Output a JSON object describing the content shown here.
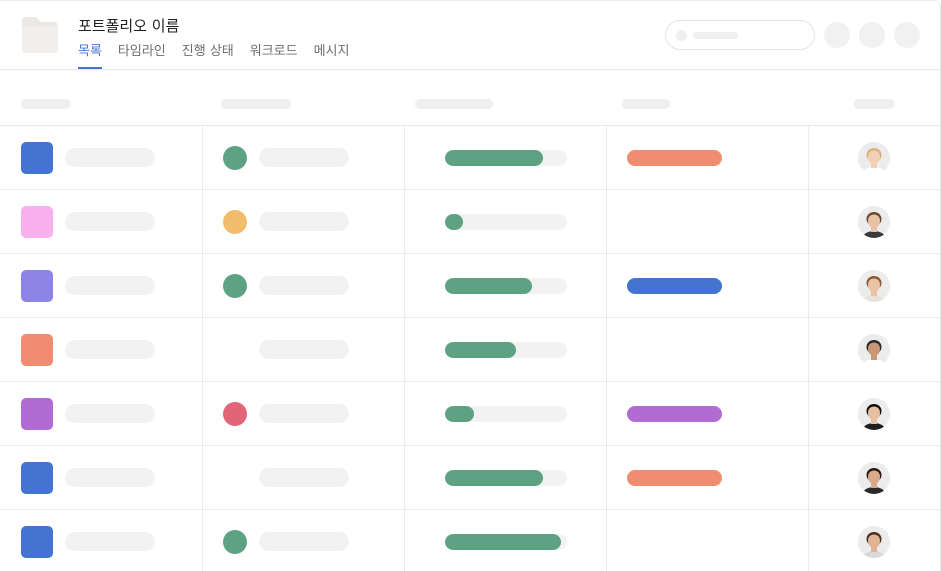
{
  "header": {
    "title": "포트폴리오 이름",
    "tabs": [
      {
        "label": "목록",
        "active": true
      },
      {
        "label": "타임라인",
        "active": false
      },
      {
        "label": "진행 상태",
        "active": false
      },
      {
        "label": "워크로드",
        "active": false
      },
      {
        "label": "메시지",
        "active": false
      }
    ]
  },
  "colors": {
    "accent": "#4573d2",
    "progress": "#5da283",
    "placeholder": "#f2f2f2"
  },
  "rows": [
    {
      "icon_color": "#4573d2",
      "status_color": "#5da283",
      "progress": 0.8,
      "tag_color": "#f08c71",
      "avatar": "person-1"
    },
    {
      "icon_color": "#f8b0ee",
      "status_color": "#f1bd6c",
      "progress": 0.15,
      "tag_color": null,
      "avatar": "person-2"
    },
    {
      "icon_color": "#8d84e8",
      "status_color": "#5da283",
      "progress": 0.71,
      "tag_color": "#4573d2",
      "avatar": "person-3"
    },
    {
      "icon_color": "#f08c71",
      "status_color": null,
      "progress": 0.58,
      "tag_color": null,
      "avatar": "person-4"
    },
    {
      "icon_color": "#b36bd4",
      "status_color": "#e16576",
      "progress": 0.24,
      "tag_color": "#b36bd4",
      "avatar": "person-5"
    },
    {
      "icon_color": "#4573d2",
      "status_color": null,
      "progress": 0.8,
      "tag_color": "#f08c71",
      "avatar": "person-6"
    },
    {
      "icon_color": "#4573d2",
      "status_color": "#5da283",
      "progress": 0.95,
      "tag_color": null,
      "avatar": "person-7"
    }
  ]
}
